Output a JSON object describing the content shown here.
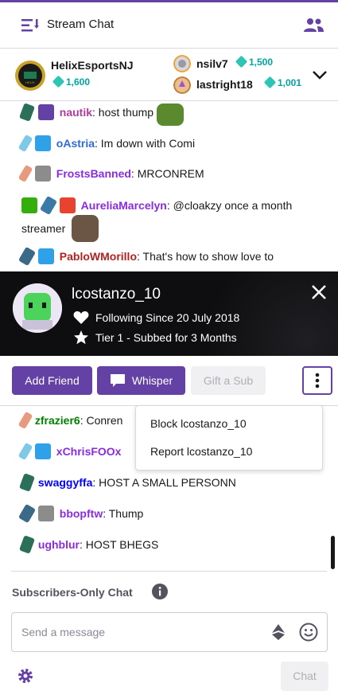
{
  "header": {
    "title": "Stream Chat",
    "menu_icon": "chat-menu-icon",
    "users_icon": "users-icon"
  },
  "leaderboard": {
    "entries": [
      {
        "name": "HelixEsportsNJ",
        "amount": "1,600",
        "badge": "helix-logo-badge"
      },
      {
        "name": "nsilv7",
        "amount": "1,500",
        "badge": "silver-badge"
      },
      {
        "name": "lastright18",
        "amount": "1,001",
        "badge": "bronze-badge"
      }
    ]
  },
  "chat": {
    "messages_top": [
      {
        "user": "nautik",
        "text": "host thump",
        "user_color": "#8a2be2",
        "emote": "pepe-emote"
      },
      {
        "user": "oAstria",
        "text": "Im down with Comi",
        "user_color": "#2e6bd8"
      },
      {
        "user": "FrostsBanned",
        "text": "MRCONREM",
        "user_color": "#8a2be2"
      },
      {
        "user": "AureliaMarcelyn",
        "text": "@cloakzy once a month",
        "text2": "streamer",
        "user_color": "#8a2be2",
        "emote": "face-emote"
      },
      {
        "user": "PabloWMorillo",
        "text": "That's how to show love to",
        "user_color": "#b22222"
      }
    ],
    "messages_bottom": [
      {
        "user": "zfrazier6",
        "text": "Conren",
        "user_color": "#008000"
      },
      {
        "user": "xChrisFOOx",
        "text": "",
        "user_color": "#8a2be2"
      },
      {
        "user": "swaggyffa",
        "text": "HOST A SMALL PERSONN",
        "user_color": "#0000ff"
      },
      {
        "user": "bbopftw",
        "text": "Thump",
        "user_color": "#8a2be2"
      },
      {
        "user": "ughblur",
        "text": "HOST BHEGS",
        "user_color": "#8a2be2"
      }
    ]
  },
  "user_card": {
    "username": "lcostanzo_10",
    "following": "Following Since 20 July 2018",
    "sub_status": "Tier 1 - Subbed for 3 Months",
    "buttons": {
      "add_friend": "Add Friend",
      "whisper": "Whisper",
      "gift_sub": "Gift a Sub"
    },
    "menu": {
      "block": "Block lcostanzo_10",
      "report": "Report lcostanzo_10"
    }
  },
  "footer": {
    "mode": "Subscribers-Only Chat",
    "placeholder": "Send a message",
    "chat_button": "Chat"
  },
  "colors": {
    "accent": "#6441a4",
    "gem": "#2ec5b6"
  }
}
